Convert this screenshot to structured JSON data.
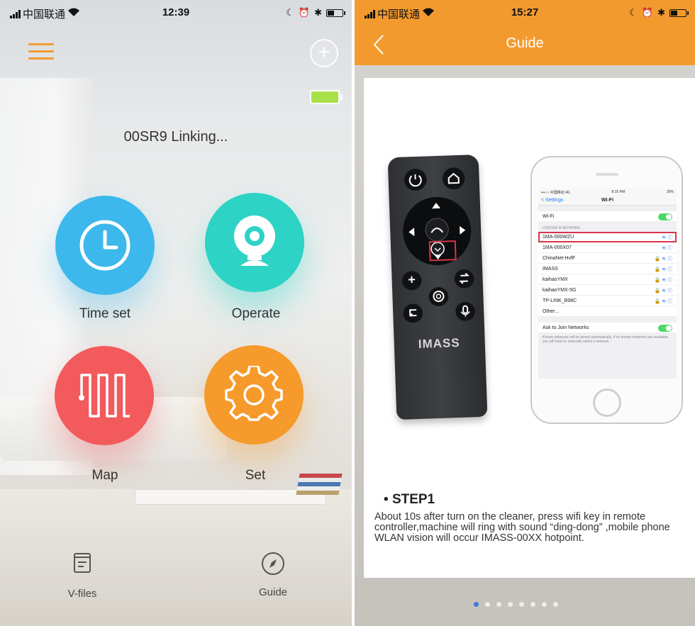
{
  "left_screen": {
    "status": {
      "carrier": "中国联通",
      "time": "12:39"
    },
    "device_status": "00SR9 Linking...",
    "features": [
      {
        "label": "Time set",
        "icon": "clock-icon",
        "color": "#3cb8ec"
      },
      {
        "label": "Operate",
        "icon": "webcam-icon",
        "color": "#2dd3c5"
      },
      {
        "label": "Map",
        "icon": "map-path-icon",
        "color": "#f25a5c"
      },
      {
        "label": "Set",
        "icon": "gear-icon",
        "color": "#f59a2b"
      }
    ],
    "bottom_nav": [
      {
        "label": "V-files",
        "icon": "document-icon"
      },
      {
        "label": "Guide",
        "icon": "compass-icon"
      }
    ],
    "accent_color": "#f39a2e",
    "battery_color": "#a8e04a"
  },
  "right_screen": {
    "status": {
      "carrier": "中国联通",
      "time": "15:27"
    },
    "title": "Guide",
    "header_color": "#f39a2e",
    "remote": {
      "brand": "IMASS"
    },
    "phone_screen": {
      "carrier": "•••○○ 中国移动 4G",
      "time": "8:15 PM",
      "battery": "30%",
      "back": "Settings",
      "title": "Wi-Fi",
      "wifi_label": "Wi-Fi",
      "choose_header": "CHOOSE A NETWORK...",
      "networks": [
        "1MA-000WZU",
        "1MA-000X07",
        "ChinaNet-HvfF",
        "IMASS",
        "kaihaoYMX",
        "kaihaoYMX-5G",
        "TP-LINK_B98C",
        "Other..."
      ],
      "ask_join": "Ask to Join Networks",
      "note": "Known networks will be joined automatically. If no known networks are available, you will have to manually select a network."
    },
    "step_title": "STEP1",
    "step_text": "About 10s after turn on the cleaner, press wifi key in remote controller,machine will ring with sound “ding-dong” ,mobile phone WLAN vision will occur IMASS-00XX hotpoint.",
    "pager": {
      "count": 8,
      "active": 1
    }
  }
}
